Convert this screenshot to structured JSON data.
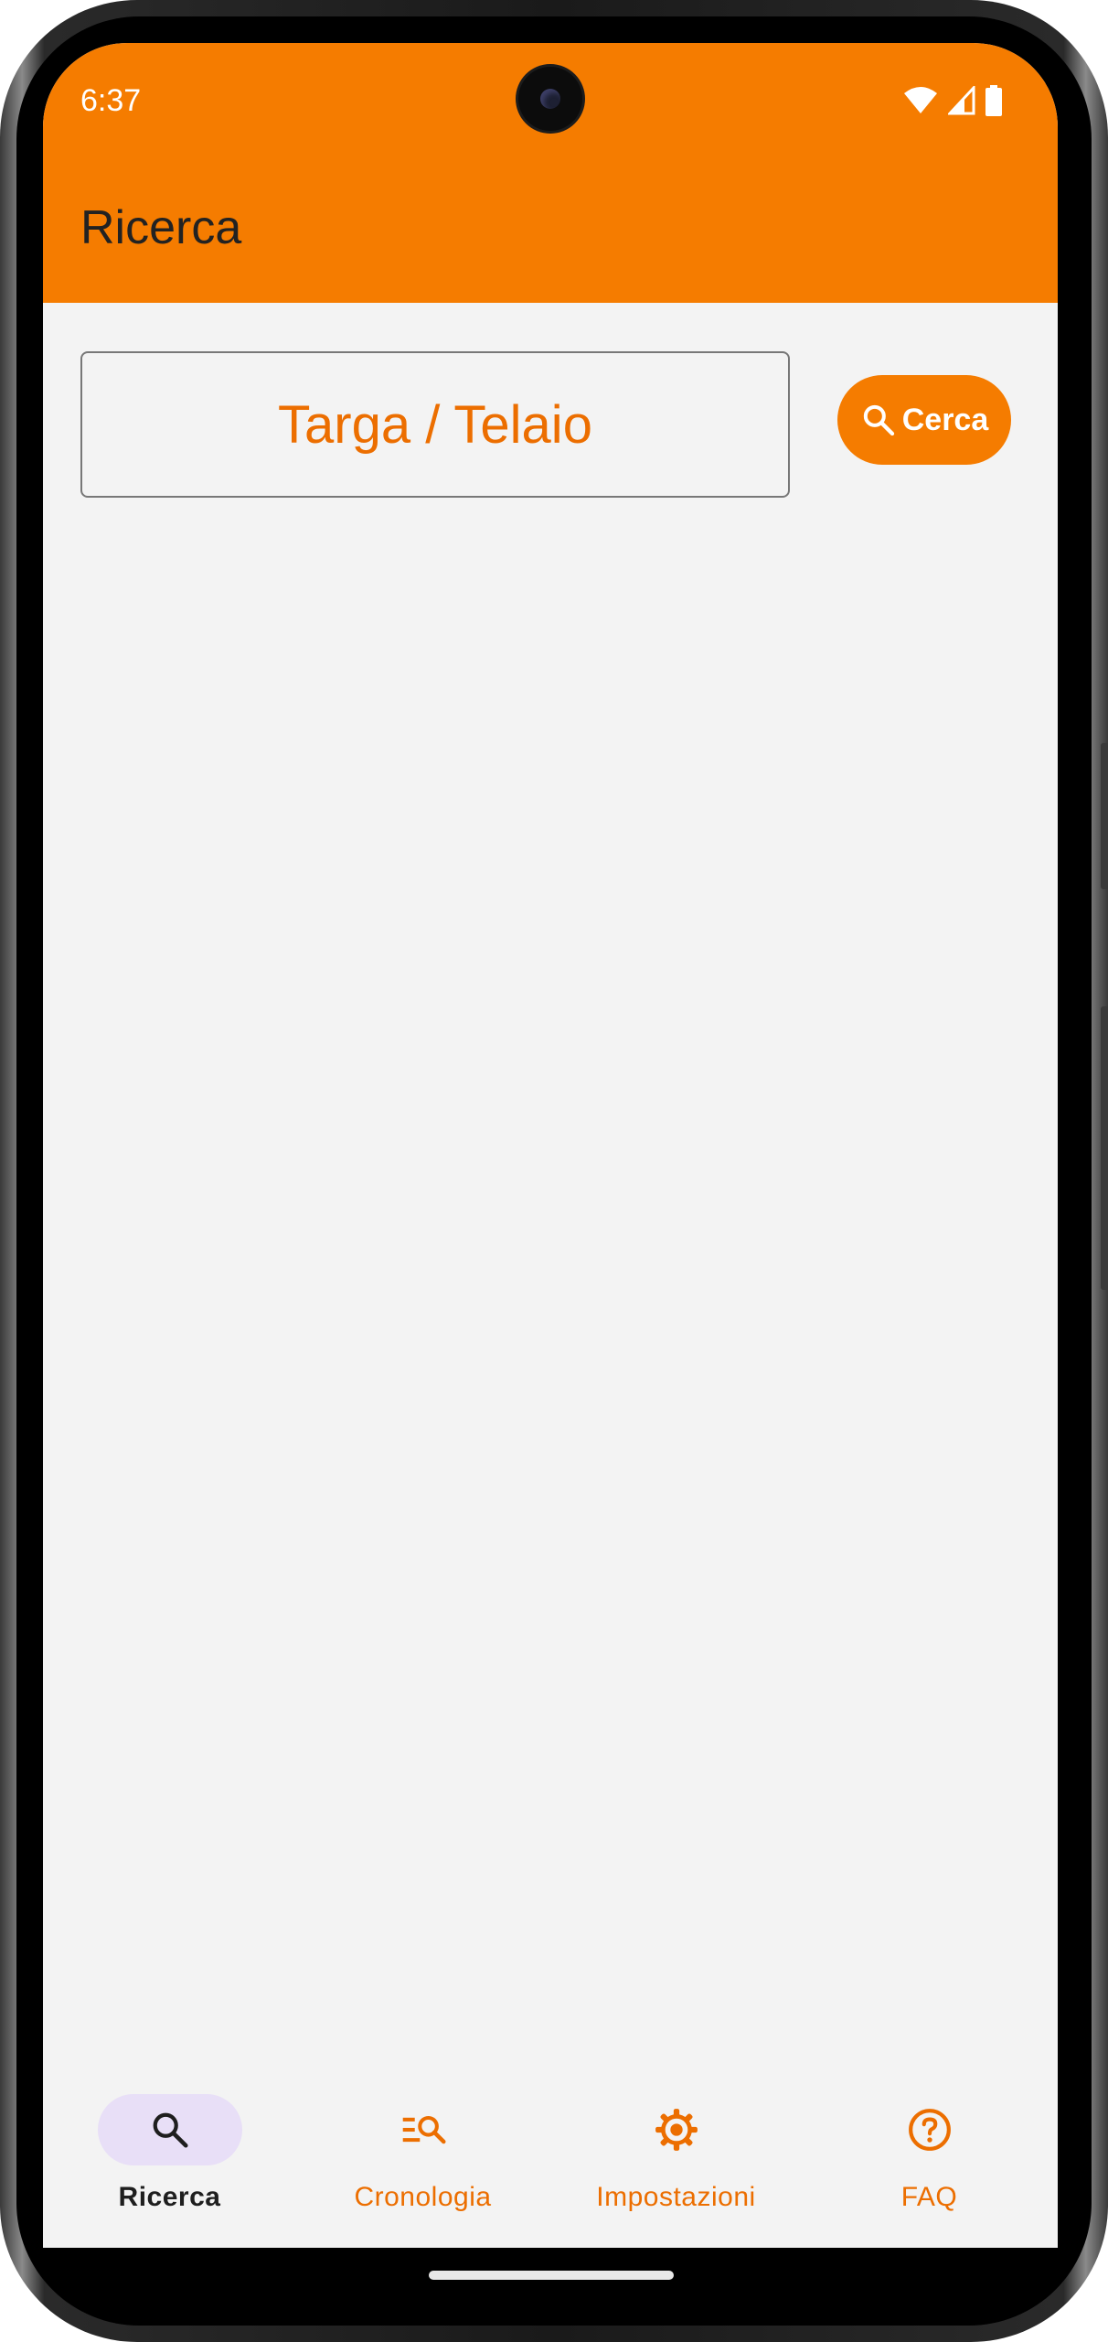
{
  "status_bar": {
    "time": "6:37",
    "icons": [
      "wifi-icon",
      "signal-icon",
      "battery-icon"
    ]
  },
  "app_bar": {
    "title": "Ricerca",
    "background_color": "#f57c00"
  },
  "search": {
    "placeholder": "Targa / Telaio",
    "button_label": "Cerca",
    "button_icon": "search-icon"
  },
  "bottom_nav": {
    "items": [
      {
        "label": "Ricerca",
        "icon": "search-icon",
        "active": true
      },
      {
        "label": "Cronologia",
        "icon": "history-search-icon",
        "active": false
      },
      {
        "label": "Impostazioni",
        "icon": "gear-icon",
        "active": false
      },
      {
        "label": "FAQ",
        "icon": "help-circle-icon",
        "active": false
      }
    ]
  },
  "colors": {
    "accent": "#f57c00",
    "accent_text": "#ec6e00",
    "active_pill": "#e8dff7",
    "background": "#f3f3f3"
  }
}
